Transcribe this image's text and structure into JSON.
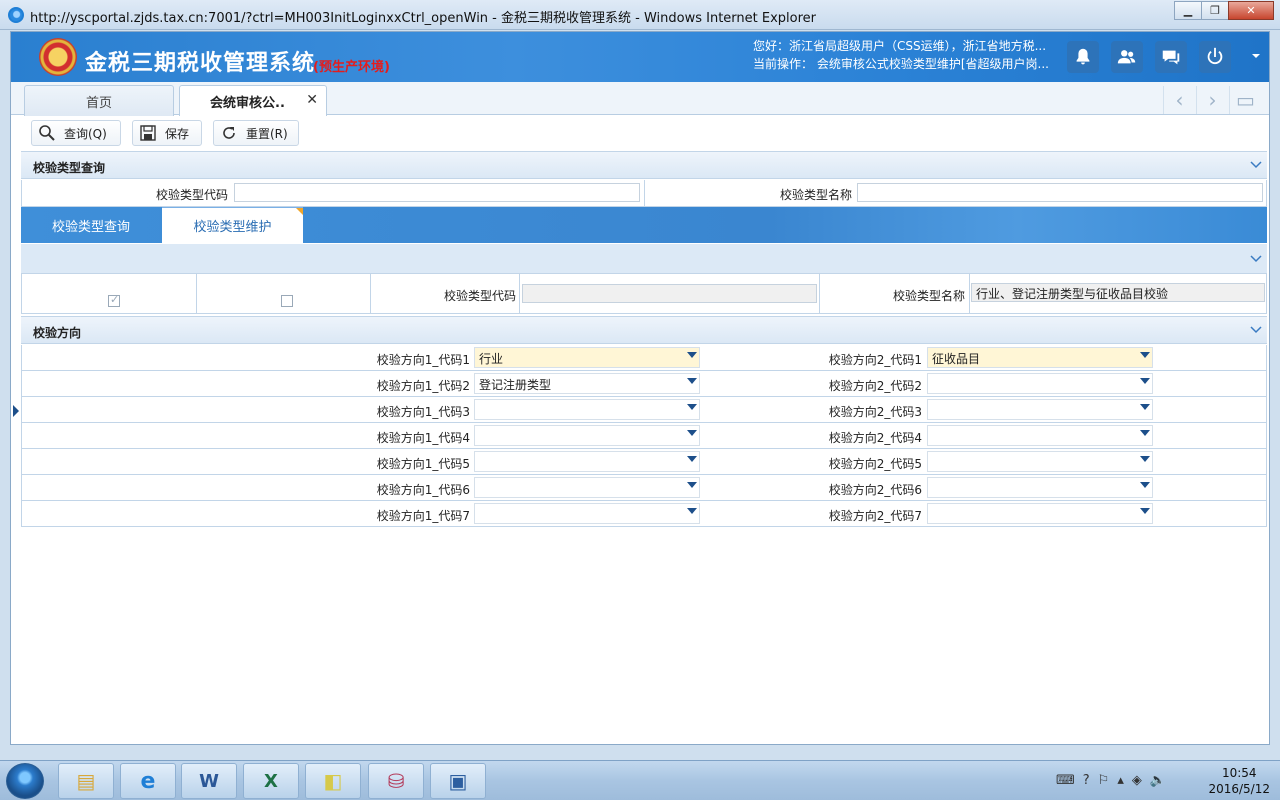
{
  "browser": {
    "title": "http://yscportal.zjds.tax.cn:7001/?ctrl=MH003InitLoginxxCtrl_openWin - 金税三期税收管理系统 - Windows Internet Explorer"
  },
  "header": {
    "app_title": "金税三期税收管理系统",
    "env_tag": "(预生产环境)",
    "greeting": "您好：浙江省局超级用户（CSS运维），浙江省地方税...",
    "current_op": "当前操作： 会统审核公式校验类型维护[省超级用户岗..."
  },
  "tabs": [
    {
      "label": "首页"
    },
    {
      "label": "会统审核公.."
    }
  ],
  "toolbar": {
    "query": "查询(Q)",
    "save": "保存",
    "reset": "重置(R)"
  },
  "query_panel": {
    "title": "校验类型查询",
    "code_label": "校验类型代码",
    "code_value": "",
    "name_label": "校验类型名称",
    "name_value": ""
  },
  "inner_tabs": [
    {
      "label": "校验类型查询"
    },
    {
      "label": "校验类型维护"
    }
  ],
  "maintain": {
    "code_label": "校验类型代码",
    "code_value": "",
    "name_label": "校验类型名称",
    "name_value": "行业、登记注册类型与征收品目校验"
  },
  "direction": {
    "title": "校验方向",
    "rows": [
      {
        "l1": "校验方向1_代码1",
        "v1": "行业",
        "l2": "校验方向2_代码1",
        "v2": "征收品目"
      },
      {
        "l1": "校验方向1_代码2",
        "v1": "登记注册类型",
        "l2": "校验方向2_代码2",
        "v2": ""
      },
      {
        "l1": "校验方向1_代码3",
        "v1": "",
        "l2": "校验方向2_代码3",
        "v2": ""
      },
      {
        "l1": "校验方向1_代码4",
        "v1": "",
        "l2": "校验方向2_代码4",
        "v2": ""
      },
      {
        "l1": "校验方向1_代码5",
        "v1": "",
        "l2": "校验方向2_代码5",
        "v2": ""
      },
      {
        "l1": "校验方向1_代码6",
        "v1": "",
        "l2": "校验方向2_代码6",
        "v2": ""
      },
      {
        "l1": "校验方向1_代码7",
        "v1": "",
        "l2": "校验方向2_代码7",
        "v2": ""
      }
    ]
  },
  "taskbar": {
    "time": "10:54",
    "date": "2016/5/12"
  }
}
